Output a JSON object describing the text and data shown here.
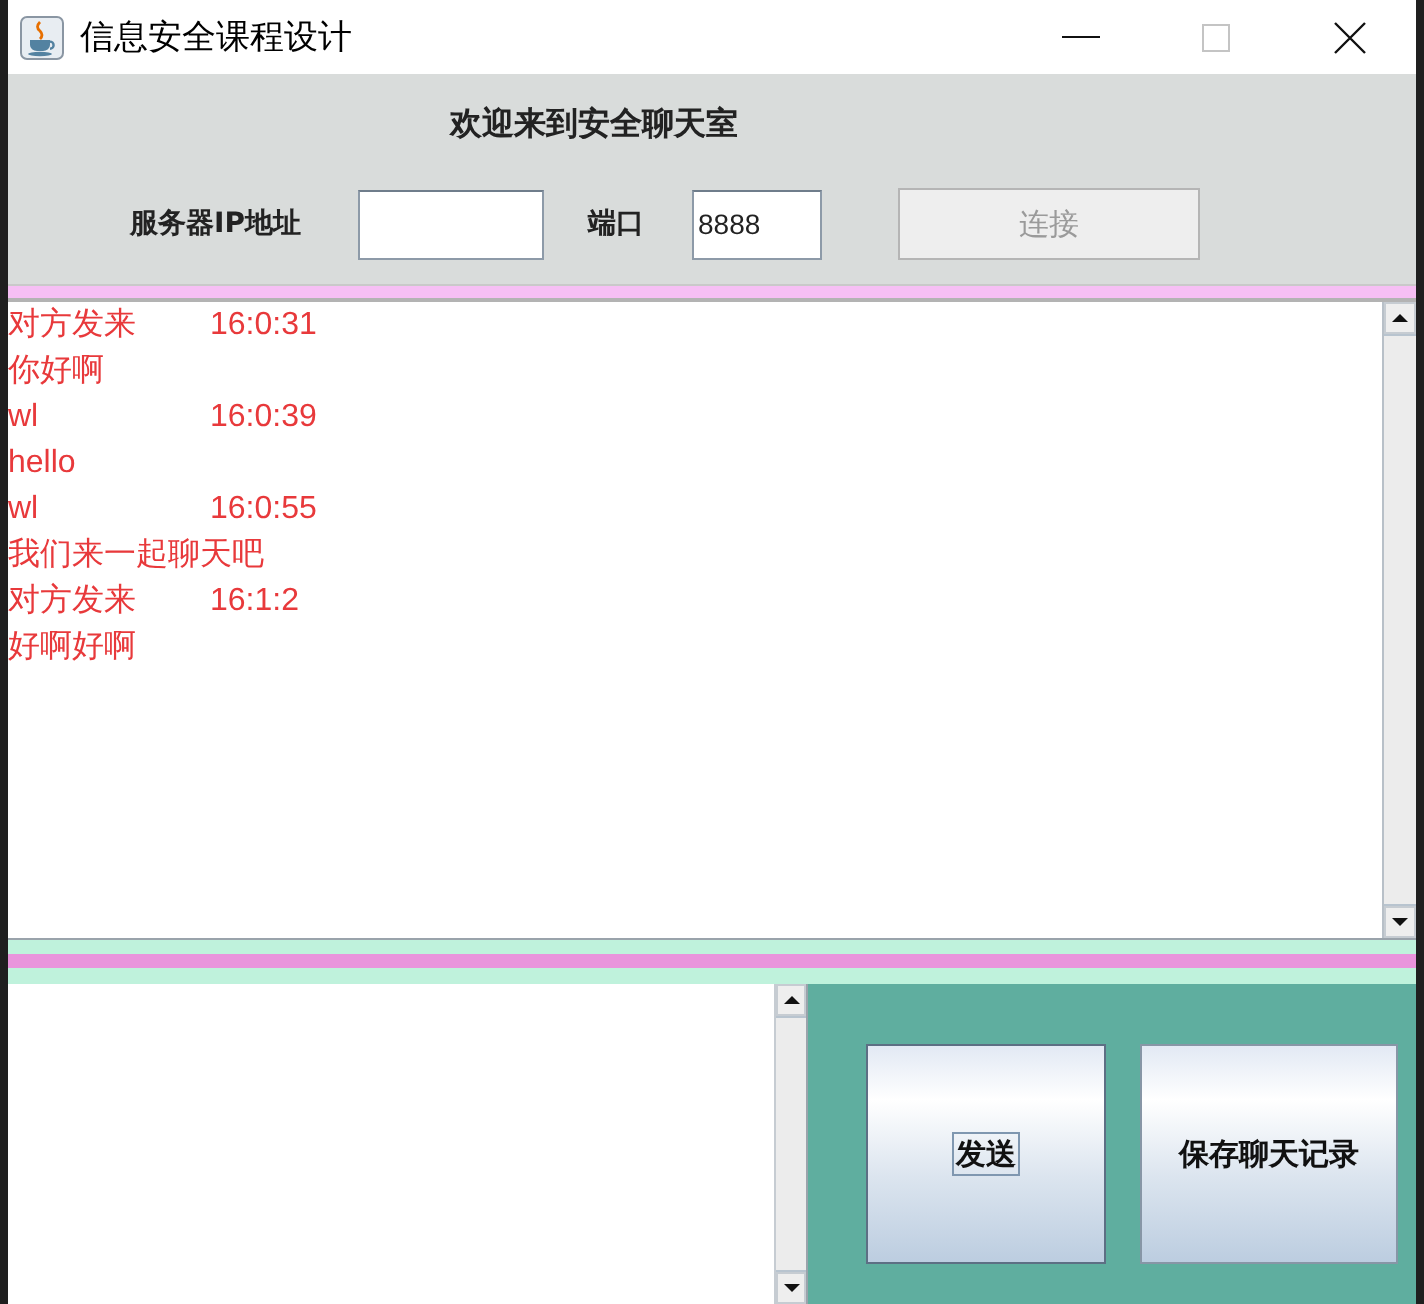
{
  "window": {
    "title": "信息安全课程设计"
  },
  "connection_panel": {
    "welcome": "欢迎来到安全聊天室",
    "server_ip_label": "服务器IP地址",
    "port_label": "端口",
    "port_value": "8888",
    "connect_button": {
      "label": "连接",
      "disabled": true
    }
  },
  "messages": [
    {
      "sender": "对方发来",
      "time": "16:0:31",
      "text": "你好啊"
    },
    {
      "sender": "wl",
      "time": "16:0:39",
      "text": "hello"
    },
    {
      "sender": "wl",
      "time": "16:0:55",
      "text": "我们来一起聊天吧"
    },
    {
      "sender": "对方发来",
      "time": "16:1:2",
      "text": "好啊好啊"
    }
  ],
  "actions": [
    {
      "label": "发送",
      "focused": true
    },
    {
      "label": "保存聊天记录",
      "focused": false
    }
  ]
}
